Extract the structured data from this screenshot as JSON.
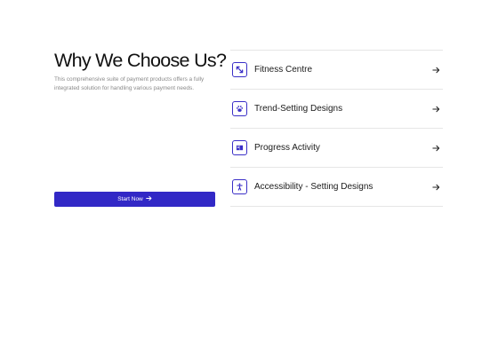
{
  "section": {
    "title": "Why We Choose Us?",
    "description": "This comprehensive suite of payment products offers a fully integrated solution for handling various payment needs.",
    "cta_label": "Start Now"
  },
  "features": [
    {
      "label": "Fitness Centre",
      "icon": "expand-arrows-icon"
    },
    {
      "label": "Trend-Setting Designs",
      "icon": "paw-icon"
    },
    {
      "label": "Progress Activity",
      "icon": "book-icon"
    },
    {
      "label": "Accessibility - Setting Designs",
      "icon": "accessibility-icon"
    }
  ],
  "colors": {
    "accent": "#3228c6",
    "text": "#111111",
    "muted": "#8a8a8a",
    "divider": "#e6e6e6"
  }
}
